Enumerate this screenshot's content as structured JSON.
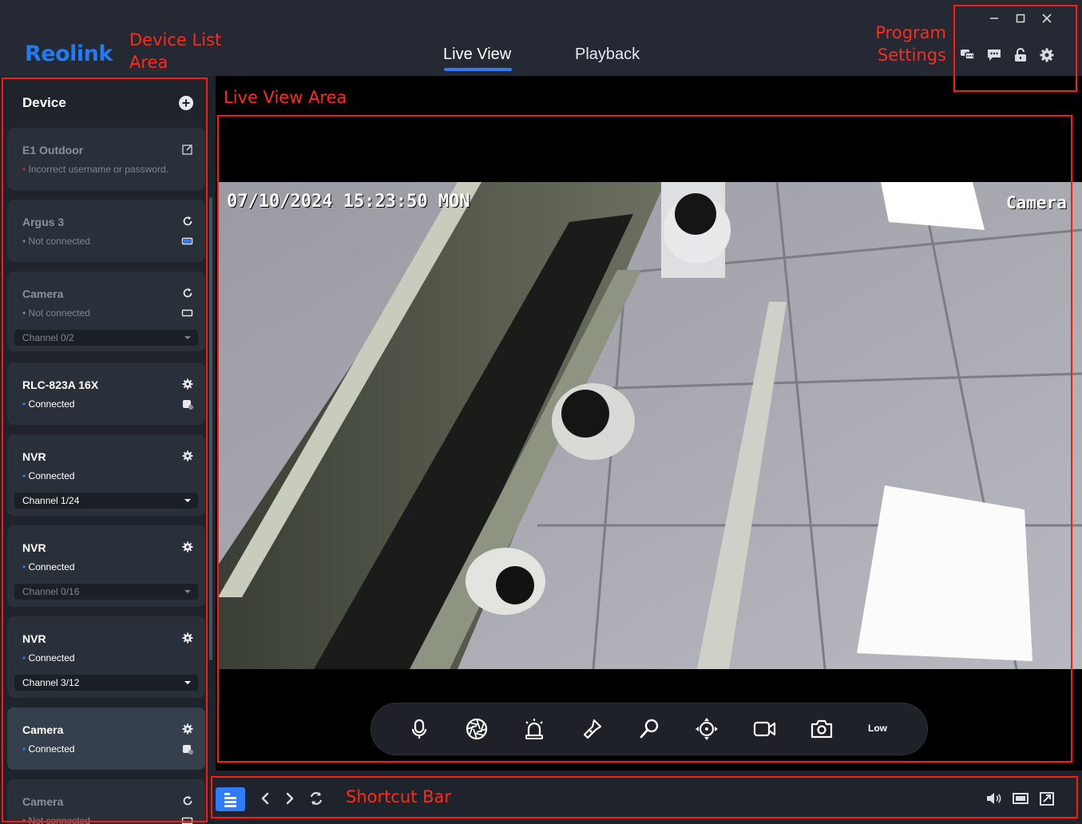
{
  "header": {
    "logo_text": "Reolink",
    "tabs": [
      {
        "label": "Live View",
        "active": true
      },
      {
        "label": "Playback",
        "active": false
      }
    ],
    "window_controls": [
      "minimize-icon",
      "maximize-icon",
      "close-icon"
    ],
    "tool_icons": [
      "chat-icon",
      "message-icon",
      "unlock-icon",
      "gear-icon"
    ]
  },
  "annotations": {
    "device_list_area": "Device List Area",
    "program_settings": "Program Settings",
    "live_view_area": "Live View Area",
    "shortcut_bar": "Shortcut Bar",
    "color": "#ff2a1a"
  },
  "sidebar": {
    "title": "Device",
    "devices": [
      {
        "name": "E1 Outdoor",
        "status": "Incorrect username or password.",
        "status_color": "#e02020",
        "state": "error"
      },
      {
        "name": "Argus 3",
        "status": "Not connected",
        "state": "offline"
      },
      {
        "name": "Camera",
        "status": "Not connected",
        "channel": "Channel 0/2",
        "state": "offline"
      },
      {
        "name": "RLC-823A 16X",
        "status": "Connected",
        "state": "online"
      },
      {
        "name": "NVR",
        "status": "Connected",
        "channel": "Channel 1/24",
        "state": "online"
      },
      {
        "name": "NVR",
        "status": "Connected",
        "channel": "Channel 0/16",
        "state": "online",
        "channel_dim": true
      },
      {
        "name": "NVR",
        "status": "Connected",
        "channel": "Channel 3/12",
        "state": "online"
      },
      {
        "name": "Camera",
        "status": "Connected",
        "state": "online",
        "selected": true
      },
      {
        "name": "Camera",
        "status": "Not connected",
        "state": "offline"
      }
    ]
  },
  "live_view": {
    "osd_datetime": "07/10/2024 15:23:50 MON",
    "osd_camera_name": "Camera",
    "controls": [
      "microphone-icon",
      "aperture-icon",
      "siren-icon",
      "flashlight-icon",
      "zoom-icon",
      "ptz-icon",
      "record-icon",
      "snapshot-icon"
    ],
    "quality_label": "Low"
  },
  "shortcut_bar": {
    "left": [
      "layout-icon",
      "prev-icon",
      "next-icon",
      "refresh-icon"
    ],
    "right": [
      "volume-icon",
      "aspect-ratio-icon",
      "fullscreen-icon"
    ]
  },
  "colors": {
    "accent": "#2f7df6",
    "online_dot": "#2f7df6",
    "error_dot": "#e02020"
  }
}
